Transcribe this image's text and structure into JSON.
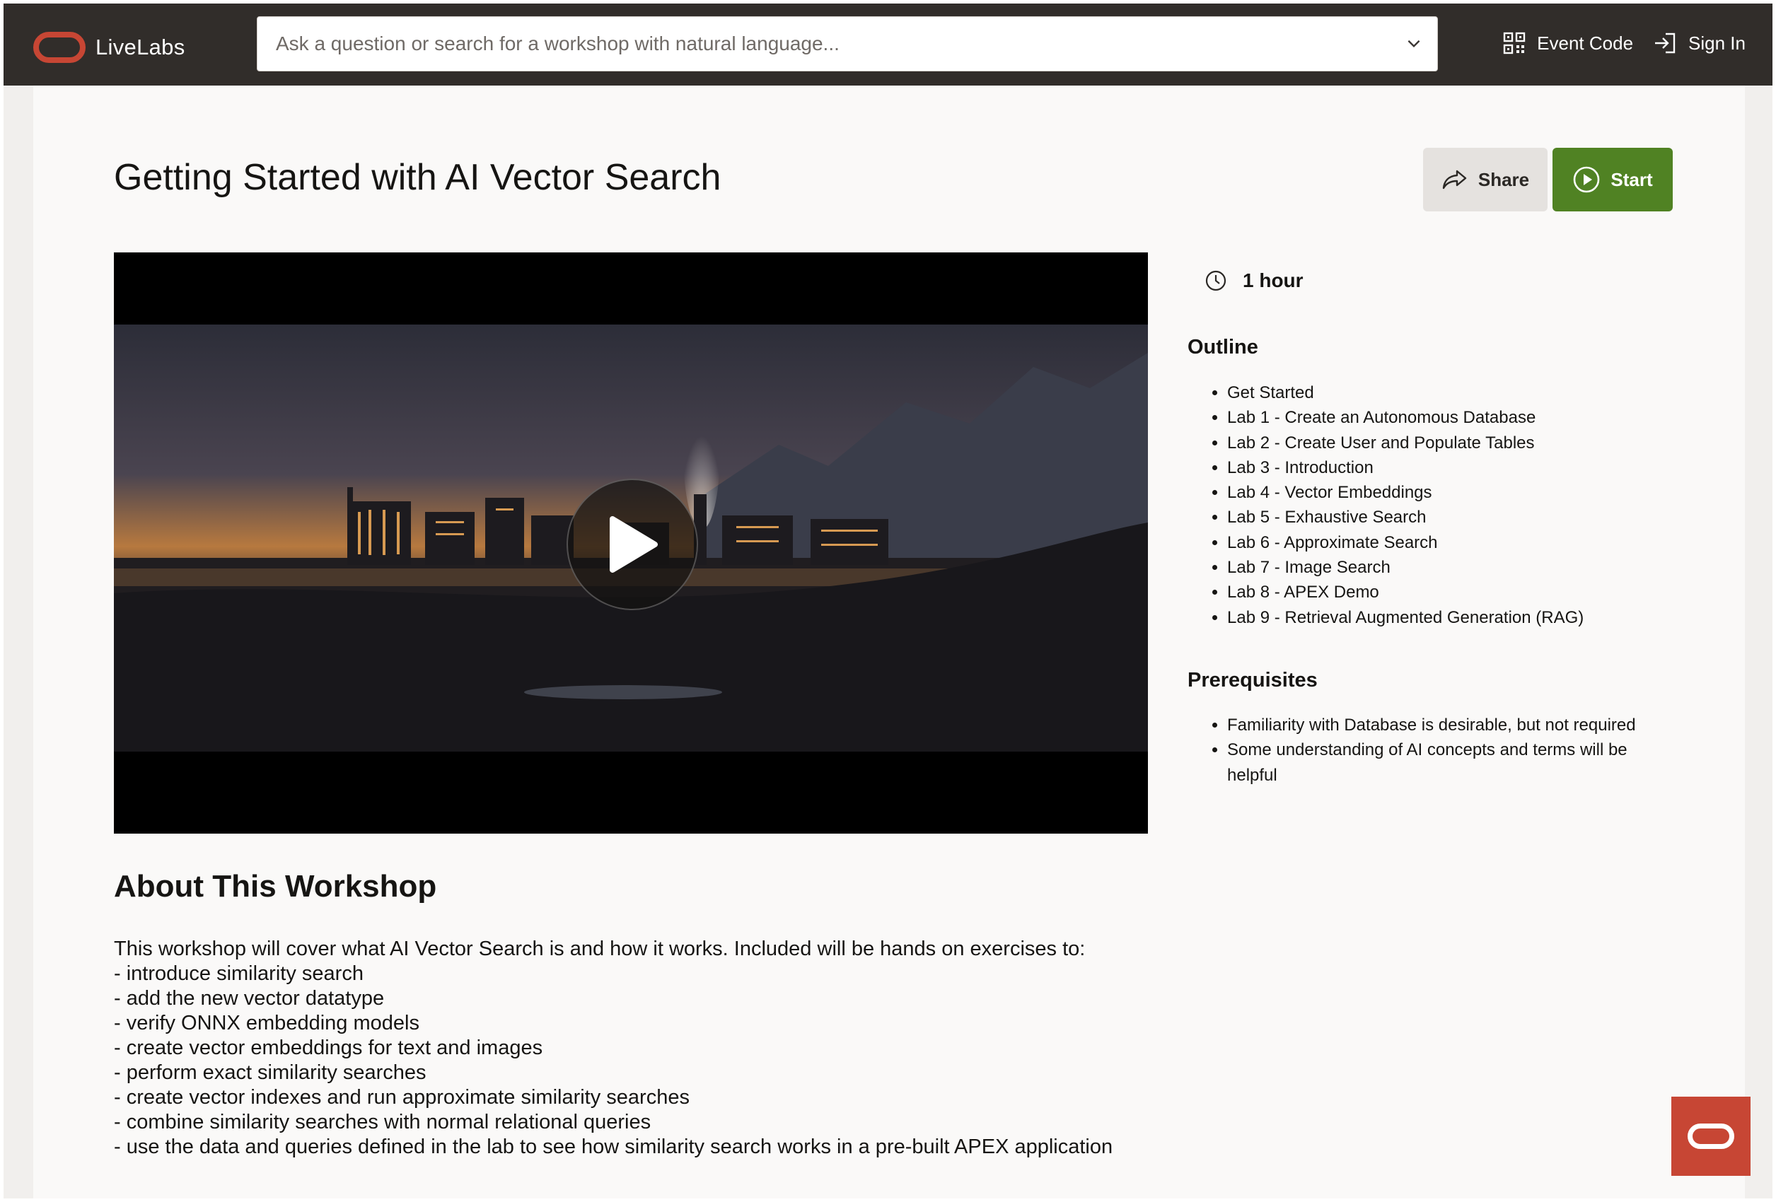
{
  "header": {
    "brand": "LiveLabs",
    "search_placeholder": "Ask a question or search for a workshop with natural language...",
    "event_code_label": "Event Code",
    "sign_in_label": "Sign In"
  },
  "workshop": {
    "title": "Getting Started with AI Vector Search",
    "share_label": "Share",
    "start_label": "Start",
    "duration": "1 hour"
  },
  "outline": {
    "heading": "Outline",
    "items": [
      "Get Started",
      "Lab 1 - Create an Autonomous Database",
      "Lab 2 - Create User and Populate Tables",
      "Lab 3 - Introduction",
      "Lab 4 - Vector Embeddings",
      "Lab 5 - Exhaustive Search",
      "Lab 6 - Approximate Search",
      "Lab 7 - Image Search",
      "Lab 8 - APEX Demo",
      "Lab 9 - Retrieval Augmented Generation (RAG)"
    ]
  },
  "prerequisites": {
    "heading": "Prerequisites",
    "items": [
      "Familiarity with Database is desirable, but not required",
      "Some understanding of AI concepts and terms will be helpful"
    ]
  },
  "about": {
    "heading": "About This Workshop",
    "lines": [
      "This workshop will cover what AI Vector Search is and how it works. Included will be hands on exercises to:",
      "- introduce similarity search",
      "- add the new vector datatype",
      "- verify ONNX embedding models",
      "- create vector embeddings for text and images",
      "- perform exact similarity searches",
      "- create vector indexes and run approximate similarity searches",
      "- combine similarity searches with normal relational queries",
      "- use the data and queries defined in the lab to see how similarity search works in a pre-built APEX application"
    ]
  },
  "colors": {
    "header_bg": "#312d2a",
    "oracle_red": "#c74634",
    "start_green": "#508223"
  }
}
